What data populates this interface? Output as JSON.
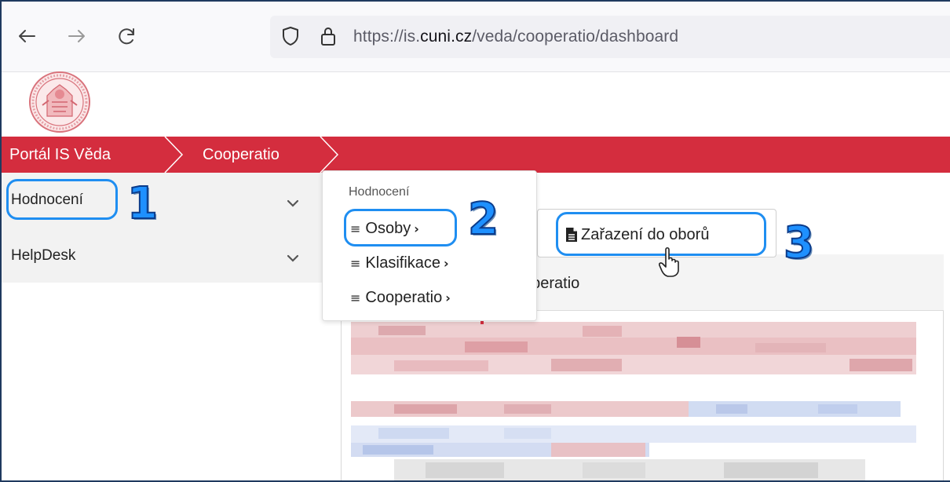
{
  "browser": {
    "back_icon": "arrow-left-icon",
    "forward_icon": "arrow-right-icon",
    "reload_icon": "reload-icon",
    "shield_icon": "shield-icon",
    "lock_icon": "lock-icon",
    "url_prefix": "https://is.",
    "url_domain": "cuni.cz",
    "url_path": "/veda/cooperatio/dashboard"
  },
  "breadcrumb": {
    "items": [
      "Portál IS Věda",
      "Cooperatio"
    ]
  },
  "sidebar": {
    "items": [
      {
        "label": "Hodnocení"
      },
      {
        "label": "HelpDesk"
      }
    ]
  },
  "dropdown": {
    "header": "Hodnocení",
    "items": [
      {
        "label": "Osoby"
      },
      {
        "label": "Klasifikace"
      },
      {
        "label": "Cooperatio"
      }
    ]
  },
  "main": {
    "button_label": "Zařazení do oborů",
    "panel_title_visible": "operatio"
  },
  "callouts": [
    "1",
    "2",
    "3"
  ],
  "colors": {
    "brand_red": "#d42d3e",
    "highlight_blue": "#1f8ef1"
  }
}
